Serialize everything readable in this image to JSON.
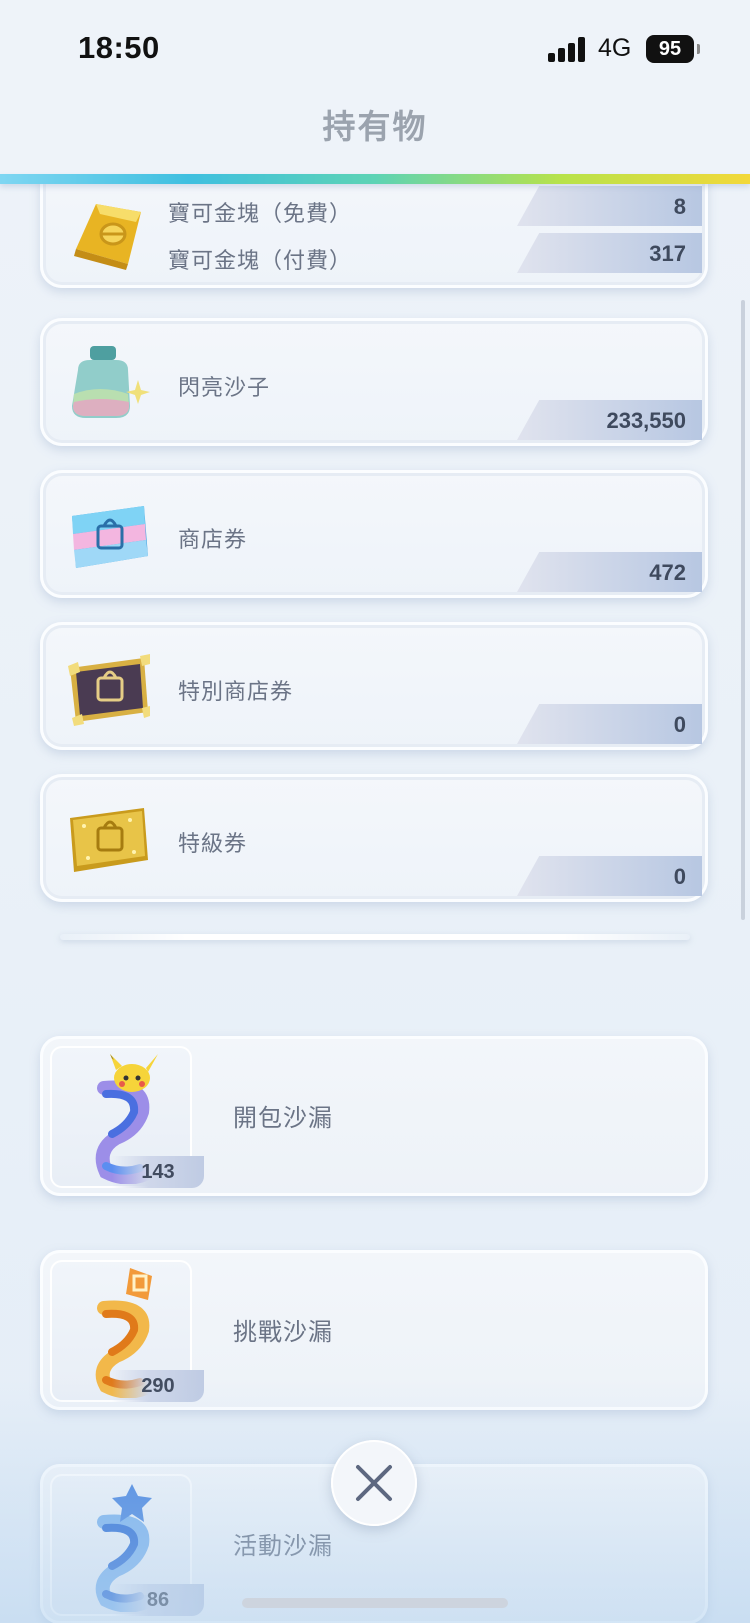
{
  "status_bar": {
    "time": "18:50",
    "network": "4G",
    "battery": "95"
  },
  "header": {
    "title": "持有物"
  },
  "currency_cards": [
    {
      "icon": "gold-ingot-icon",
      "rows": [
        {
          "label": "寶可金塊（免費）",
          "value": "8"
        },
        {
          "label": "寶可金塊（付費）",
          "value": "317"
        }
      ]
    },
    {
      "icon": "shiny-sand-jar-icon",
      "label": "閃亮沙子",
      "value": "233,550"
    },
    {
      "icon": "shop-ticket-icon",
      "label": "商店券",
      "value": "472"
    },
    {
      "icon": "special-shop-ticket-icon",
      "label": "特別商店券",
      "value": "0"
    },
    {
      "icon": "premium-ticket-icon",
      "label": "特級券",
      "value": "0"
    }
  ],
  "hourglasses": [
    {
      "icon": "pack-hourglass-icon",
      "label": "開包沙漏",
      "count": "143"
    },
    {
      "icon": "challenge-hourglass-icon",
      "label": "挑戰沙漏",
      "count": "290"
    },
    {
      "icon": "event-hourglass-icon",
      "label": "活動沙漏",
      "count": "86"
    }
  ],
  "colors": {
    "accent_gradient": [
      "#7fd6f2",
      "#5dd3b5",
      "#f3d83a"
    ],
    "value_text": "#3f4a5e"
  }
}
